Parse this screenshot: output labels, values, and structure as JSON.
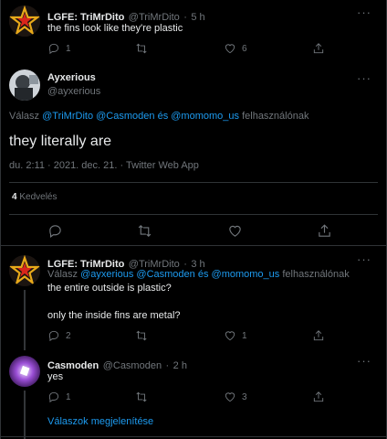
{
  "tweet1": {
    "name": "LGFE: TriMrDito",
    "handle": "@TriMrDito",
    "sep": "·",
    "time": "5 h",
    "text": "the fins look like they're plastic",
    "replies": "1",
    "retweets": "",
    "likes": "6"
  },
  "main": {
    "name": "Ayxerious",
    "handle": "@ayxerious",
    "reply_prefix": "Válasz",
    "mention1": "@TriMrDito",
    "mention2": "@Casmoden",
    "and_word": "és",
    "mention3": "@momomo_us",
    "reply_suffix": "felhasználónak",
    "text": "they literally are",
    "timestamp": "du. 2:11 · 2021. dec. 21. · Twitter Web App",
    "likes_count": "4",
    "likes_label": "Kedvelés"
  },
  "tweet2": {
    "name": "LGFE: TriMrDito",
    "handle": "@TriMrDito",
    "sep": "·",
    "time": "3 h",
    "reply_prefix": "Válasz",
    "mention1": "@ayxerious",
    "mention2": "@Casmoden",
    "and_word": "és",
    "mention3": "@momomo_us",
    "reply_suffix": "felhasználónak",
    "line1": "the entire outside is plastic?",
    "line2": "only the inside fins are metal?",
    "replies": "2",
    "retweets": "",
    "likes": "1"
  },
  "tweet3": {
    "name": "Casmoden",
    "handle": "@Casmoden",
    "sep": "·",
    "time": "2 h",
    "text": "yes",
    "replies": "1",
    "retweets": "",
    "likes": "3"
  },
  "show_replies": "Válaszok megjelenítése",
  "colors": {
    "background": "#000000",
    "link": "#1d9bf0",
    "muted": "#71767b",
    "border": "#2f3336"
  }
}
